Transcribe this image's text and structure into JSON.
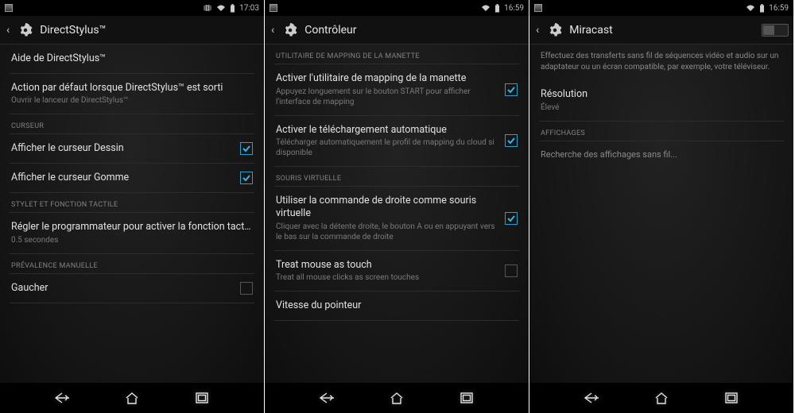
{
  "accent": "#33b5e5",
  "screen1": {
    "time": "17:03",
    "title": "DirectStylus™",
    "rows": [
      {
        "label": "Aide de DirectStylus™"
      },
      {
        "label": "Action par défaut lorsque DirectStylus™ est sorti",
        "sub": "Ouvrir le lanceur de DirectStylus™"
      }
    ],
    "header1": "CURSEUR",
    "cursorRows": [
      {
        "label": "Afficher le curseur Dessin",
        "checked": true
      },
      {
        "label": "Afficher le curseur Gomme",
        "checked": true
      }
    ],
    "header2": "STYLET ET FONCTION TACTILE",
    "timerRow": {
      "label": "Régler le programmateur pour activer la fonction tactile après l'u",
      "sub": "0.5 secondes"
    },
    "header3": "PRÉVALENCE MANUELLE",
    "handRow": {
      "label": "Gaucher",
      "checked": false
    }
  },
  "screen2": {
    "time": "16:59",
    "title": "Contrôleur",
    "header1": "UTILITAIRE DE MAPPING DE LA MANETTE",
    "rows1": [
      {
        "label": "Activer l'utilitaire de mapping de la manette",
        "sub": "Appuyez longuement sur le bouton START pour afficher l'interface de mapping",
        "checked": true
      },
      {
        "label": "Activer le téléchargement automatique",
        "sub": "Télécharger automatiquement le profil de mapping du cloud si disponible",
        "checked": true
      }
    ],
    "header2": "SOURIS VIRTUELLE",
    "rows2": [
      {
        "label": "Utiliser la commande de droite comme souris virtuelle",
        "sub": "Cliquer avec la détente droite, le bouton A ou en appuyant vers le bas sur la commande de droite",
        "checked": true
      },
      {
        "label": "Treat mouse as touch",
        "sub": "Treat all mouse clicks as screen touches",
        "checked": false
      }
    ],
    "pointerRow": {
      "label": "Vitesse du pointeur"
    }
  },
  "screen3": {
    "time": "16:59",
    "title": "Miracast",
    "desc": "Effectuez des transferts sans fil de séquences vidéo et audio sur un adaptateur ou un écran compatible, par exemple, votre téléviseur.",
    "resRow": {
      "label": "Résolution",
      "sub": "Élevé"
    },
    "header1": "AFFICHAGES",
    "searchRow": {
      "label": "Recherche des affichages sans fil..."
    },
    "toggle": "off"
  }
}
